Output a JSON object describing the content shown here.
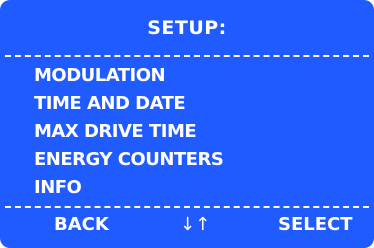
{
  "title": "SETUP:",
  "menu": {
    "items": [
      {
        "label": "MODULATION"
      },
      {
        "label": "TIME AND DATE"
      },
      {
        "label": "MAX DRIVE TIME"
      },
      {
        "label": "ENERGY COUNTERS"
      },
      {
        "label": "INFO"
      }
    ]
  },
  "footer": {
    "back_label": "BACK",
    "arrows_label": "↓↑",
    "select_label": "SELECT"
  },
  "colors": {
    "screen_background": "#1f5bff",
    "text": "#ffffff"
  }
}
